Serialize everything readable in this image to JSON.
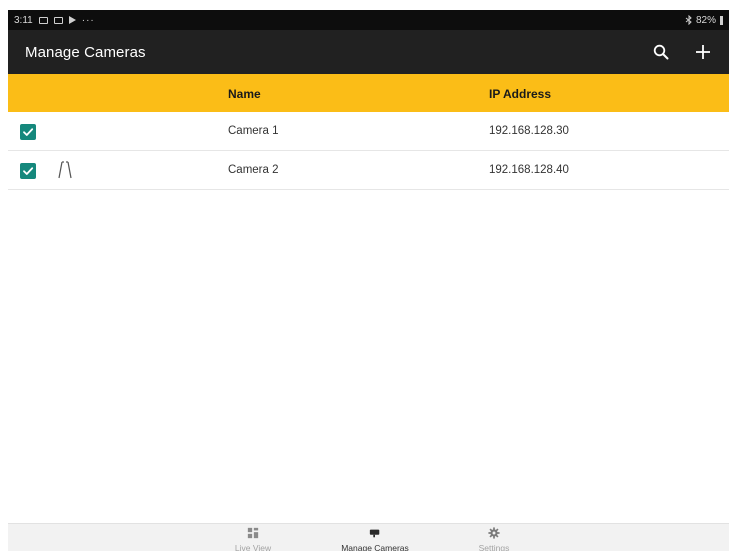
{
  "status_bar": {
    "time": "3:11",
    "overflow": "···",
    "battery": "82%",
    "icons": [
      "image-icon",
      "image-icon",
      "play-store-icon",
      "battery-icon"
    ]
  },
  "app_bar": {
    "title": "Manage Cameras",
    "actions": [
      {
        "name": "search-button",
        "icon": "search-icon"
      },
      {
        "name": "add-camera-button",
        "icon": "plus-icon"
      }
    ]
  },
  "table": {
    "columns": {
      "name": "Name",
      "ip": "IP Address"
    },
    "rows": [
      {
        "checked": true,
        "icon": "",
        "name": "Camera 1",
        "ip": "192.168.128.30"
      },
      {
        "checked": true,
        "icon": "road-icon",
        "name": "Camera 2",
        "ip": "192.168.128.40"
      }
    ]
  },
  "bottom_nav": {
    "items": [
      {
        "label": "Live View",
        "icon": "grid-icon",
        "active": false
      },
      {
        "label": "Manage Cameras",
        "icon": "camera-icon",
        "active": true
      },
      {
        "label": "Settings",
        "icon": "gear-icon",
        "active": false
      }
    ]
  },
  "colors": {
    "app_bar": "#212121",
    "status_bar": "#0d0d0d",
    "header_accent": "#fbbd17",
    "checkbox": "#15887c",
    "bottom_nav": "#f2f2f2"
  }
}
